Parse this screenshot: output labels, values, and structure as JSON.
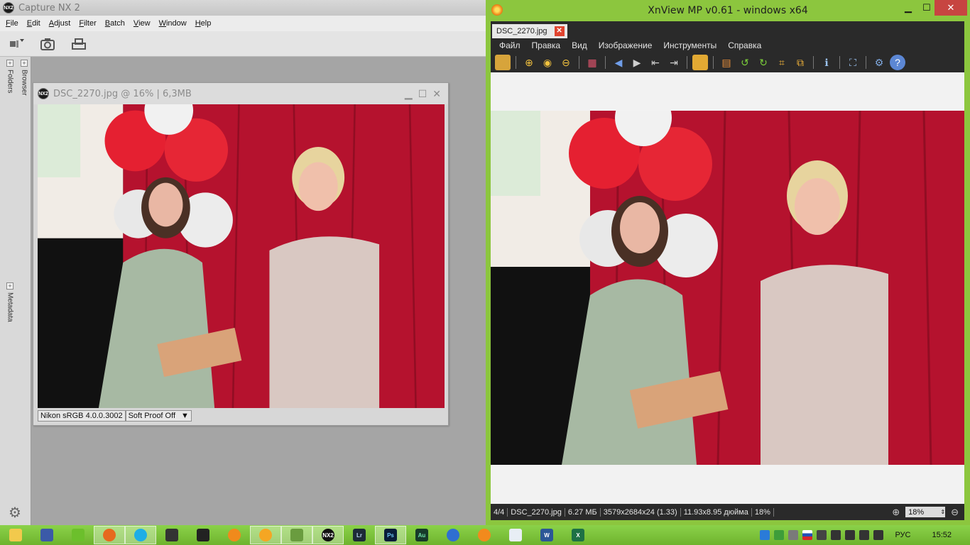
{
  "capture_nx": {
    "title": "Capture NX 2",
    "logo_text": "NX2",
    "menu": [
      "File",
      "Edit",
      "Adjust",
      "Filter",
      "Batch",
      "View",
      "Window",
      "Help"
    ],
    "sidebar_tabs": [
      "Folders",
      "Browser",
      "Metadata"
    ],
    "document": {
      "title": "DSC_2270.jpg @ 16% | 6,3MB",
      "profile": "Nikon sRGB 4.0.0.3002",
      "soft_proof": "Soft Proof Off"
    }
  },
  "xnview": {
    "title": "XnView MP v0.61 - windows x64",
    "tab_label": "DSC_2270.jpg",
    "menu": [
      "Файл",
      "Правка",
      "Вид",
      "Изображение",
      "Инструменты",
      "Справка"
    ],
    "toolbar_icons": [
      "browser-icon",
      "zoom-in-icon",
      "zoom-fit-icon",
      "zoom-out-icon",
      "grid-icon",
      "back-icon",
      "forward-icon",
      "first-icon",
      "last-icon",
      "slideshow-icon",
      "adjust-icon",
      "rotate-left-icon",
      "rotate-right-icon",
      "crop-icon",
      "resize-icon",
      "info-icon",
      "fullscreen-icon",
      "settings-icon",
      "help-icon"
    ],
    "status": {
      "index": "4/4",
      "filename": "DSC_2270.jpg",
      "filesize": "6.27 МБ",
      "dimensions": "3579x2684x24 (1.33)",
      "print_size": "11.93x8.95 дюйма",
      "zoom": "18%"
    },
    "zoom_box": "18%"
  },
  "taskbar": {
    "apps": [
      "explorer",
      "save",
      "utorrent",
      "firefox",
      "skype",
      "alien",
      "clapper",
      "xnview-orange",
      "xnview-active",
      "viewer",
      "capture-nx",
      "lightroom",
      "photoshop",
      "audition",
      "browser",
      "sun",
      "remote",
      "word",
      "excel"
    ],
    "app_labels": {
      "capture-nx": "NX2",
      "lightroom": "Lr",
      "photoshop": "Ps",
      "audition": "Au",
      "word": "W",
      "excel": "X"
    },
    "language": "РУС",
    "time": "15:52"
  },
  "colors": {
    "xnview_border": "#8cc63e",
    "taskbar": "#7cc23a",
    "curtain": "#b5122e",
    "dark_ui": "#2a2a2a"
  }
}
